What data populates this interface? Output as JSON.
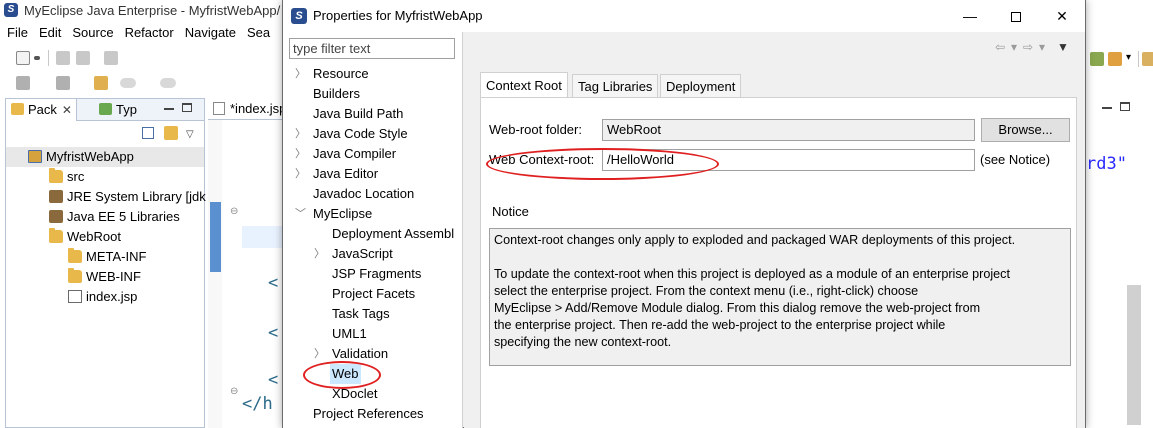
{
  "ide": {
    "window_title": "MyEclipse Java Enterprise - MyfristWebApp/",
    "menu": [
      "File",
      "Edit",
      "Source",
      "Refactor",
      "Navigate",
      "Sea"
    ],
    "package_explorer": {
      "tab_pack": "Pack",
      "tab_type": "Typ",
      "tree": [
        {
          "label": "MyfristWebApp",
          "icon": "project-icon"
        },
        {
          "label": "src",
          "icon": "package-folder-icon"
        },
        {
          "label": "JRE System Library [jdk",
          "icon": "library-icon"
        },
        {
          "label": "Java EE 5 Libraries",
          "icon": "library-icon"
        },
        {
          "label": "WebRoot",
          "icon": "folder-icon"
        },
        {
          "label": "META-INF",
          "icon": "folder-icon"
        },
        {
          "label": "WEB-INF",
          "icon": "folder-icon"
        },
        {
          "label": "index.jsp",
          "icon": "jsp-file-icon"
        }
      ]
    },
    "editor": {
      "tab_label": "*index.jsp",
      "code_lines": [
        "<",
        "<",
        "<",
        "</h"
      ]
    },
    "right_code_fragment": "rd3\""
  },
  "dialog": {
    "title": "Properties for MyfristWebApp",
    "filter_placeholder": "type filter text",
    "tree": [
      {
        "label": "Resource",
        "expandable": true
      },
      {
        "label": "Builders",
        "expandable": false
      },
      {
        "label": "Java Build Path",
        "expandable": false
      },
      {
        "label": "Java Code Style",
        "expandable": true
      },
      {
        "label": "Java Compiler",
        "expandable": true
      },
      {
        "label": "Java Editor",
        "expandable": true
      },
      {
        "label": "Javadoc Location",
        "expandable": false
      },
      {
        "label": "MyEclipse",
        "expandable": true,
        "expanded": true
      },
      {
        "label": "Deployment Assembl",
        "expandable": false
      },
      {
        "label": "JavaScript",
        "expandable": true
      },
      {
        "label": "JSP Fragments",
        "expandable": false
      },
      {
        "label": "Project Facets",
        "expandable": false
      },
      {
        "label": "Task Tags",
        "expandable": false
      },
      {
        "label": "UML1",
        "expandable": false
      },
      {
        "label": "Validation",
        "expandable": true
      },
      {
        "label": "Web",
        "expandable": false,
        "selected": true
      },
      {
        "label": "XDoclet",
        "expandable": false
      },
      {
        "label": "Project References",
        "expandable": false
      }
    ],
    "tabs": [
      "Context Root",
      "Tag Libraries",
      "Deployment"
    ],
    "active_tab": "Context Root",
    "webroot_label": "Web-root folder:",
    "webroot_value": "WebRoot",
    "browse_label": "Browse...",
    "context_label": "Web Context-root:",
    "context_value": "/HelloWorld",
    "see_notice": "(see Notice)",
    "notice_heading": "Notice",
    "notice_text": "Context-root changes only apply to exploded and packaged WAR deployments of this project.\n\nTo update the context-root when this project is deployed as a module of an enterprise project\nselect the enterprise project. From the context menu (i.e., right-click) choose\nMyEclipse > Add/Remove Module dialog. From this dialog remove the web-project from\nthe enterprise project. Then re-add the web-project to the enterprise project while\nspecifying the new context-root."
  },
  "colors": {
    "selection": "#cce8ff",
    "annotation_circle": "#e02020",
    "dialog_bg": "#f0f0f0"
  }
}
